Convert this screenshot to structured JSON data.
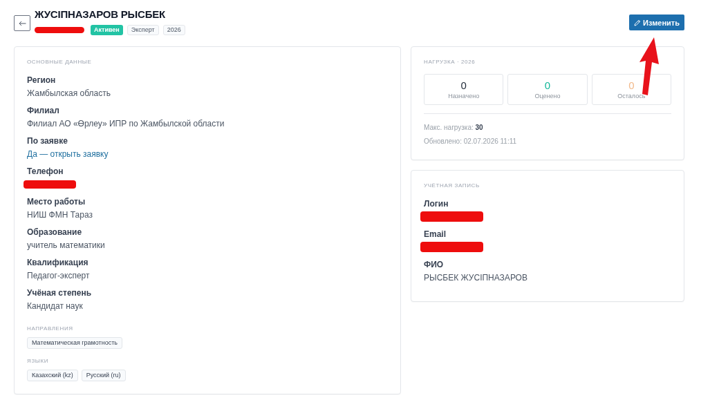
{
  "header": {
    "title": "ЖУСІПНАЗАРОВ РЫСБЕК",
    "badges": [
      {
        "kind": "redacted"
      },
      {
        "kind": "status",
        "label": "Активен"
      },
      {
        "kind": "tag",
        "label": "Эксперт"
      },
      {
        "kind": "tag",
        "label": "2026"
      }
    ],
    "edit_button": "Изменить"
  },
  "main_card": {
    "heading": "ОСНОВНЫЕ ДАННЫЕ",
    "fields": [
      {
        "label": "Регион",
        "kind": "text",
        "value": "Жамбылская область"
      },
      {
        "label": "Филиал",
        "kind": "text",
        "value": "Филиал АО «Өрлеу» ИПР по Жамбылской области"
      },
      {
        "label": "По заявке",
        "kind": "link",
        "value": "Да — открыть заявку"
      },
      {
        "label": "Телефон",
        "kind": "redacted"
      },
      {
        "label": "Место работы",
        "kind": "text",
        "value": "НИШ ФМН Тараз"
      },
      {
        "label": "Образование",
        "kind": "text",
        "value": "учитель математики"
      },
      {
        "label": "Квалификация",
        "kind": "text",
        "value": "Педагог-эксперт"
      },
      {
        "label": "Учёная степень",
        "kind": "text",
        "value": "Кандидат наук"
      }
    ],
    "tag_groups": [
      {
        "heading": "НАПРАВЛЕНИЯ",
        "chips": [
          "Математическая грамотность"
        ]
      },
      {
        "heading": "ЯЗЫКИ",
        "chips": [
          "Казахский (kz)",
          "Русский (ru)"
        ]
      }
    ]
  },
  "workload_card": {
    "heading": "НАГРУЗКА · 2026",
    "stats": [
      {
        "value": "0",
        "label": "Назначено",
        "color": "#1f2937"
      },
      {
        "value": "0",
        "label": "Оценено",
        "color": "#14b89a"
      },
      {
        "value": "0",
        "label": "Осталось",
        "color": "#f2b98a"
      }
    ],
    "max_load": "Макс. нагрузка: **30**",
    "updated": "Обновлено: 02.07.2026 11:11"
  },
  "account_card": {
    "heading": "УЧЁТНАЯ ЗАПИСЬ",
    "fields": [
      {
        "label": "Логин",
        "kind": "redacted"
      },
      {
        "label": "Email",
        "kind": "redacted"
      },
      {
        "label": "ФИО",
        "kind": "text",
        "value": "РЫСБЕК ЖУСІПНАЗАРОВ"
      }
    ]
  },
  "annotations": [
    {
      "kind": "arrow"
    }
  ]
}
